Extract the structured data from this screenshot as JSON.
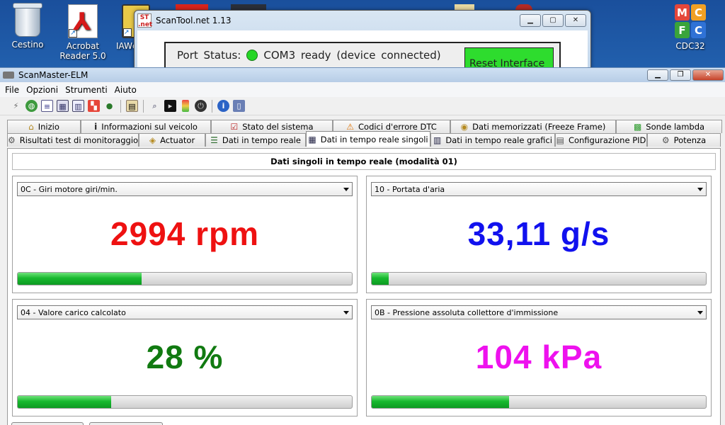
{
  "desktop": {
    "icons": [
      {
        "label": "Cestino",
        "icon": "recycle-bin-icon"
      },
      {
        "label": "Acrobat Reader 5.0",
        "icon": "acrobat-reader-icon"
      },
      {
        "label": "IAWc",
        "icon": "program-shortcut-icon"
      },
      {
        "label": "CDC32",
        "icon": "cdc32-icon"
      }
    ],
    "cdc32_letters": [
      "M",
      "C",
      "F",
      "C"
    ]
  },
  "scantool": {
    "title": "ScanTool.net 1.13",
    "logo": "ST .net",
    "port_label": "Port Status:",
    "port_status": "COM3 ready (device connected)",
    "reset_label": "Reset Interface"
  },
  "app": {
    "title": "ScanMaster-ELM",
    "menu": [
      "File",
      "Opzioni",
      "Strumenti",
      "Aiuto"
    ],
    "tabs_row1": [
      {
        "label": "Inizio",
        "icon": "house-icon"
      },
      {
        "label": "Informazioni sul veicolo",
        "icon": "info-icon"
      },
      {
        "label": "Stato del sistema",
        "icon": "checklist-icon"
      },
      {
        "label": "Codici d'errore DTC",
        "icon": "warning-icon"
      },
      {
        "label": "Dati memorizzati (Freeze Frame)",
        "icon": "snapshot-icon"
      },
      {
        "label": "Sonde lambda",
        "icon": "lambda-sensor-icon"
      }
    ],
    "tabs_row2": [
      {
        "label": "Risultati test di monitoraggio",
        "icon": "gear-icon"
      },
      {
        "label": "Actuator",
        "icon": "actuator-icon"
      },
      {
        "label": "Dati in tempo reale",
        "icon": "list-icon"
      },
      {
        "label": "Dati in tempo reale singoli",
        "icon": "grid-icon"
      },
      {
        "label": "Dati in tempo reale grafici",
        "icon": "chart-icon"
      },
      {
        "label": "Configurazione PID",
        "icon": "config-icon"
      },
      {
        "label": "Potenza",
        "icon": "engine-icon"
      }
    ],
    "active_tab": "Dati in tempo reale singoli",
    "heading": "Dati singoli in tempo reale (modalità 01)",
    "panels": [
      {
        "pid": "0C - Giri motore giri/min.",
        "value": "2994 rpm",
        "color": "#ee1111",
        "level": 0.37
      },
      {
        "pid": "10 - Portata d'aria",
        "value": "33,11 g/s",
        "color": "#1111ee",
        "level": 0.05
      },
      {
        "pid": "04 - Valore carico calcolato",
        "value": "28 %",
        "color": "#117a11",
        "level": 0.28
      },
      {
        "pid": "0B - Pressione assoluta collettore d'immissione",
        "value": "104 kPa",
        "color": "#ee11ee",
        "level": 0.41
      }
    ]
  }
}
